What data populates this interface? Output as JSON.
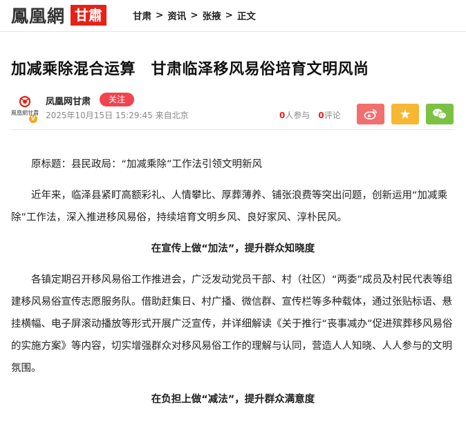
{
  "header": {
    "logo_text": "鳳凰網",
    "region_badge": "甘肅",
    "breadcrumb": [
      "甘肃",
      "资讯",
      "张掖",
      "正文"
    ],
    "breadcrumb_sep": ">"
  },
  "article": {
    "title": "加减乘除混合运算　甘肃临泽移风易俗培育文明风尚",
    "source": "凤凰网甘肃",
    "follow_label": "关注",
    "avatar_text": "鳳凰網甘肅",
    "timestamp": "2025年10月15日 15:29:45 来自北京",
    "participants_count": "0",
    "participants_label": "人参与",
    "comments_count": "0",
    "comments_label": "评论",
    "paragraphs": [
      "原标题：县民政局：“加减乘除”工作法引领文明新风",
      "近年来，临泽县紧盯高额彩礼、人情攀比、厚葬薄养、铺张浪费等突出问题，创新运用“加减乘除”工作法，深入推进移风易俗，持续培育文明乡风、良好家风、淳朴民风。",
      "在宣传上做“加法”，提升群众知晓度",
      "各镇定期召开移风易俗工作推进会，广泛发动党员干部、村（社区）“两委”成员及村民代表等组建移风易俗宣传志愿服务队。借助赶集日、村广播、微信群、宣传栏等多种载体，通过张贴标语、悬挂横幅、电子屏滚动播放等形式开展广泛宣传，并详细解读《关于推行“丧事减办”促进殡葬移风易俗的实施方案》等内容，切实增强群众对移风易俗工作的理解与认同，营造人人知晓、人人参与的文明氛围。",
      "在负担上做“减法”，提升群众满意度"
    ]
  },
  "colors": {
    "brand_red": "#e62117",
    "follow": "#f0444f",
    "weibo": "#f26f6f",
    "favorite": "#f7b733",
    "wechat": "#7bc143"
  },
  "icons": {
    "weibo": "weibo-icon",
    "favorite": "star-icon",
    "wechat": "wechat-icon",
    "avatar": "phoenix-icon"
  }
}
